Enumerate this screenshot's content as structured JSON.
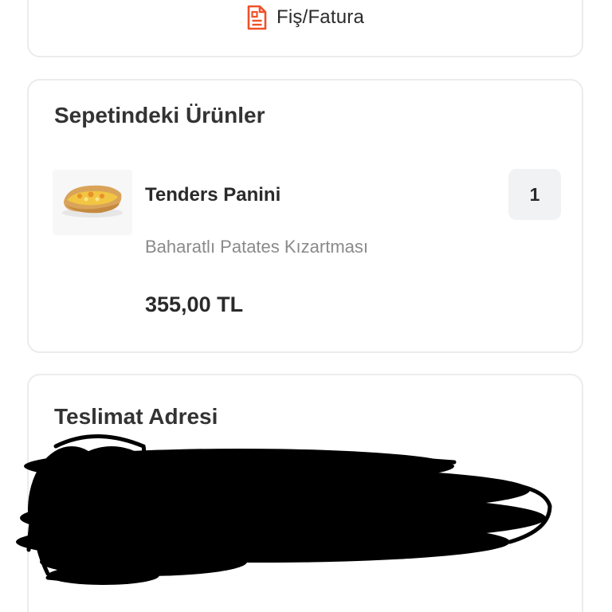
{
  "receipt": {
    "label": "Fiş/Fatura",
    "icon": "receipt-icon",
    "accent_color": "#f0502a"
  },
  "basket": {
    "title": "Sepetindeki Ürünler",
    "items": [
      {
        "name": "Tenders Panini",
        "option": "Baharatlı Patates Kızartması",
        "price": "355,00 TL",
        "quantity": "1",
        "image": "tenders-panini-photo"
      }
    ]
  },
  "address": {
    "title": "Teslimat Adresi",
    "redacted": true
  }
}
